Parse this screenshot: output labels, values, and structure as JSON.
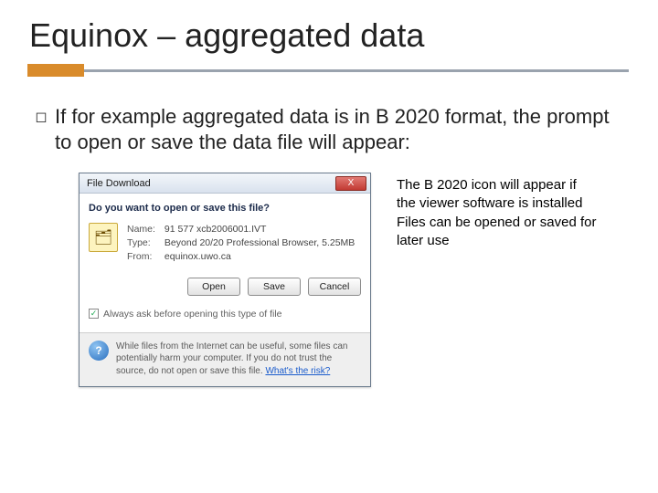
{
  "title": "Equinox – aggregated data",
  "bullet": "If for example aggregated data is in B 2020 format, the prompt to open or save the data file will appear:",
  "side_note": {
    "l1": "The B 2020 icon will appear if the viewer software is installed",
    "l2": "Files can be opened or saved for later use"
  },
  "dialog": {
    "title": "File Download",
    "close_glyph": "X",
    "question": "Do you want to open or save this file?",
    "icon_glyph": "🗂",
    "name_label": "Name:",
    "name_value": "91 577 xcb2006001.IVT",
    "type_label": "Type:",
    "type_value": "Beyond 20/20 Professional Browser, 5.25MB",
    "from_label": "From:",
    "from_value": "equinox.uwo.ca",
    "open": "Open",
    "save": "Save",
    "cancel": "Cancel",
    "always_ask": "Always ask before opening this type of file",
    "check_glyph": "✓",
    "shield_glyph": "?",
    "warn_text": "While files from the Internet can be useful, some files can potentially harm your computer. If you do not trust the source, do not open or save this file. ",
    "risk_link": "What's the risk?"
  }
}
